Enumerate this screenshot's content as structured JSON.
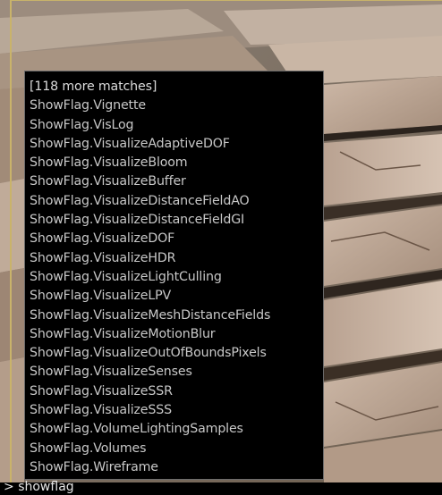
{
  "autocomplete": {
    "header": "[118 more matches]",
    "items": [
      "ShowFlag.Vignette",
      "ShowFlag.VisLog",
      "ShowFlag.VisualizeAdaptiveDOF",
      "ShowFlag.VisualizeBloom",
      "ShowFlag.VisualizeBuffer",
      "ShowFlag.VisualizeDistanceFieldAO",
      "ShowFlag.VisualizeDistanceFieldGI",
      "ShowFlag.VisualizeDOF",
      "ShowFlag.VisualizeHDR",
      "ShowFlag.VisualizeLightCulling",
      "ShowFlag.VisualizeLPV",
      "ShowFlag.VisualizeMeshDistanceFields",
      "ShowFlag.VisualizeMotionBlur",
      "ShowFlag.VisualizeOutOfBoundsPixels",
      "ShowFlag.VisualizeSenses",
      "ShowFlag.VisualizeSSR",
      "ShowFlag.VisualizeSSS",
      "ShowFlag.VolumeLightingSamples",
      "ShowFlag.Volumes",
      "ShowFlag.Wireframe"
    ]
  },
  "console": {
    "prompt": ">",
    "input": "showflag"
  }
}
